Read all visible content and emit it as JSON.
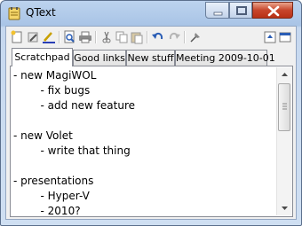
{
  "window": {
    "title": "QText"
  },
  "toolbar": {
    "buttons": [
      "new-note-icon",
      "rename-icon",
      "format-icon",
      "print-preview-icon",
      "print-icon",
      "cut-icon",
      "copy-icon",
      "paste-icon",
      "undo-icon",
      "redo-icon",
      "goto-icon",
      "options-icon",
      "about-icon"
    ]
  },
  "tabs": [
    {
      "label": "Scratchpad",
      "active": true
    },
    {
      "label": "Good links",
      "active": false
    },
    {
      "label": "New stuff",
      "active": false
    },
    {
      "label": "Meeting 2009-10-01",
      "active": false
    }
  ],
  "editor": {
    "lines": [
      "- new MagiWOL",
      "        - fix bugs",
      "        - add new feature",
      "",
      "- new Volet",
      "        - write that thing",
      "",
      "- presentations",
      "        - Hyper-V",
      "        - 2010?"
    ]
  },
  "colors": {
    "accent": "#c7452b",
    "frame": "#bcd3ee"
  }
}
